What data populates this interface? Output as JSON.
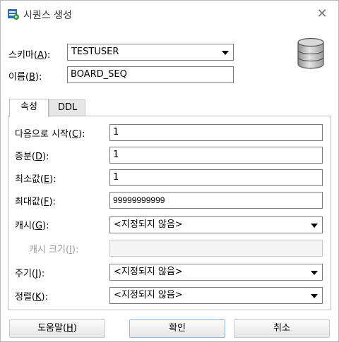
{
  "window": {
    "title": "시퀀스 생성"
  },
  "schema": {
    "label_prefix": "스키마(",
    "label_key": "A",
    "label_suffix": "):",
    "value": "TESTUSER"
  },
  "name": {
    "label_prefix": "이름(",
    "label_key": "B",
    "label_suffix": "):",
    "value": "BOARD_SEQ"
  },
  "tabs": [
    {
      "label": "속성",
      "active": true
    },
    {
      "label": "DDL",
      "active": false
    }
  ],
  "properties": {
    "start": {
      "label_prefix": "다음으로 시작(",
      "label_key": "C",
      "label_suffix": "):",
      "value": "1"
    },
    "increment": {
      "label_prefix": "증분(",
      "label_key": "D",
      "label_suffix": "):",
      "value": "1"
    },
    "min": {
      "label_prefix": "최소값(",
      "label_key": "E",
      "label_suffix": "):",
      "value": "1"
    },
    "max": {
      "label_prefix": "최대값(",
      "label_key": "F",
      "label_suffix": "):",
      "value": "99999999999"
    },
    "cache": {
      "label_prefix": "캐시(",
      "label_key": "G",
      "label_suffix": "):",
      "value": "<지정되지 않음>"
    },
    "cache_size": {
      "label_prefix": "캐시 크기(",
      "label_key": "I",
      "label_suffix": "):",
      "value": ""
    },
    "cycle": {
      "label_prefix": "주기(",
      "label_key": "J",
      "label_suffix": "):",
      "value": "<지정되지 않음>"
    },
    "order": {
      "label_prefix": "정렬(",
      "label_key": "K",
      "label_suffix": "):",
      "value": "<지정되지 않음>"
    }
  },
  "buttons": {
    "help_prefix": "도움말(",
    "help_key": "H",
    "help_suffix": ")",
    "ok": "확인",
    "cancel": "취소"
  },
  "icons": {
    "title": "sequence-icon",
    "close": "close-icon",
    "database": "database-icon"
  },
  "colors": {
    "icon_blue": "#2f6db5",
    "icon_green": "#2e9b3a",
    "default_button_border": "#8fb6dc"
  }
}
